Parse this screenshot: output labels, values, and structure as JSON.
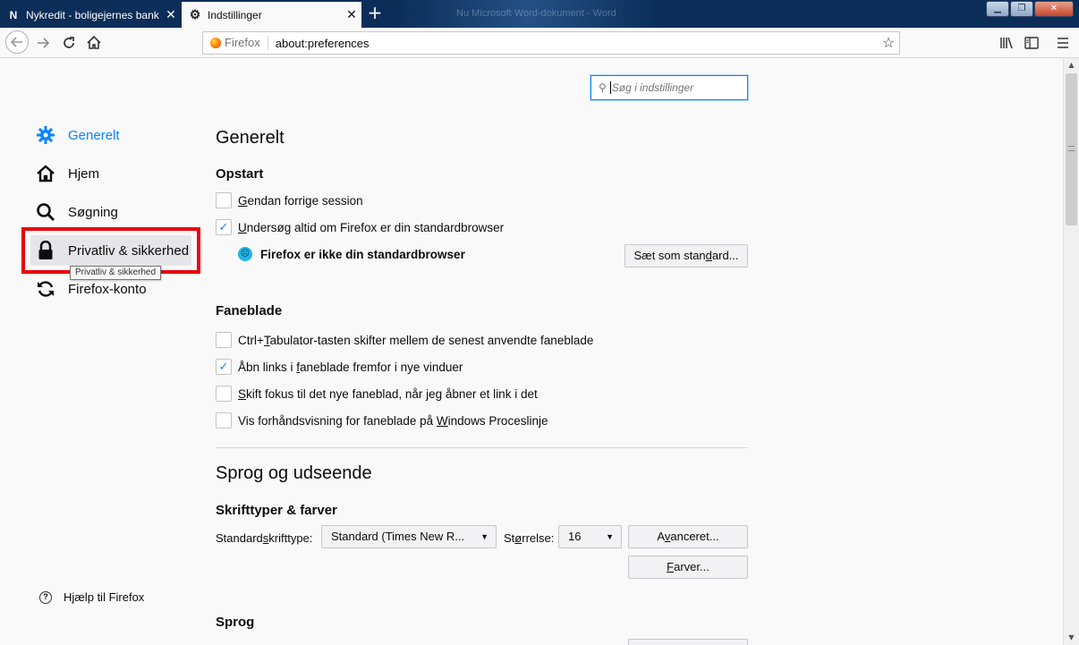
{
  "tabs": [
    {
      "label": "Nykredit - boligejernes bank",
      "favicon": "N",
      "close": "✕"
    },
    {
      "label": "Indstillinger",
      "favicon": "⚙",
      "close": "✕"
    }
  ],
  "newtab": "+",
  "window_ghost_title": "Nu Microsoft Word-dokument - Word",
  "urlbar": {
    "identity": "Firefox",
    "url": "about:preferences"
  },
  "search": {
    "placeholder": "Søg i indstillinger"
  },
  "sidebar": {
    "items": [
      {
        "label": "Generelt",
        "icon": "gear-icon"
      },
      {
        "label": "Hjem",
        "icon": "home-icon"
      },
      {
        "label": "Søgning",
        "icon": "search-icon"
      },
      {
        "label": "Privatliv & sikkerhed",
        "icon": "lock-icon"
      },
      {
        "label": "Firefox-konto",
        "icon": "sync-icon"
      }
    ],
    "tooltip": "Privatliv & sikkerhed",
    "help": "Hjælp til Firefox"
  },
  "general": {
    "title": "Generelt",
    "startup": {
      "heading": "Opstart",
      "restore_session": {
        "pre": "",
        "key": "G",
        "post": "endan forrige session",
        "checked": false
      },
      "check_default": {
        "pre": "",
        "key": "U",
        "post": "ndersøg altid om Firefox er din standardbrowser",
        "checked": true
      },
      "not_default": "Firefox er ikke din standardbrowser",
      "set_default_button": {
        "pre": "Sæt som stan",
        "key": "d",
        "post": "ard..."
      }
    },
    "tabs_section": {
      "heading": "Faneblade",
      "items": [
        {
          "pre": "Ctrl+",
          "key": "T",
          "post": "abulator-tasten skifter mellem de senest anvendte faneblade",
          "checked": false
        },
        {
          "pre": "Åbn links i ",
          "key": "f",
          "post": "aneblade fremfor i nye vinduer",
          "checked": true
        },
        {
          "pre": "",
          "key": "S",
          "post": "kift fokus til det nye faneblad, når jeg åbner et link i det",
          "checked": false
        },
        {
          "pre": "Vis forhåndsvisning for faneblade på ",
          "key": "W",
          "post": "indows Proceslinje",
          "checked": false
        }
      ]
    }
  },
  "language_appearance": {
    "title": "Sprog og udseende",
    "fonts": {
      "heading": "Skrifttyper & farver",
      "default_font_label": {
        "pre": "Standard",
        "key": "s",
        "post": "krifttype:"
      },
      "default_font_value": "Standard (Times New R...",
      "size_label": {
        "pre": "St",
        "key": "ø",
        "post": "rrelse:"
      },
      "size_value": "16",
      "advanced_button": {
        "pre": "A",
        "key": "v",
        "post": "anceret..."
      },
      "colors_button": {
        "pre": "",
        "key": "F",
        "post": "arver..."
      }
    },
    "language_heading": "Sprog"
  }
}
